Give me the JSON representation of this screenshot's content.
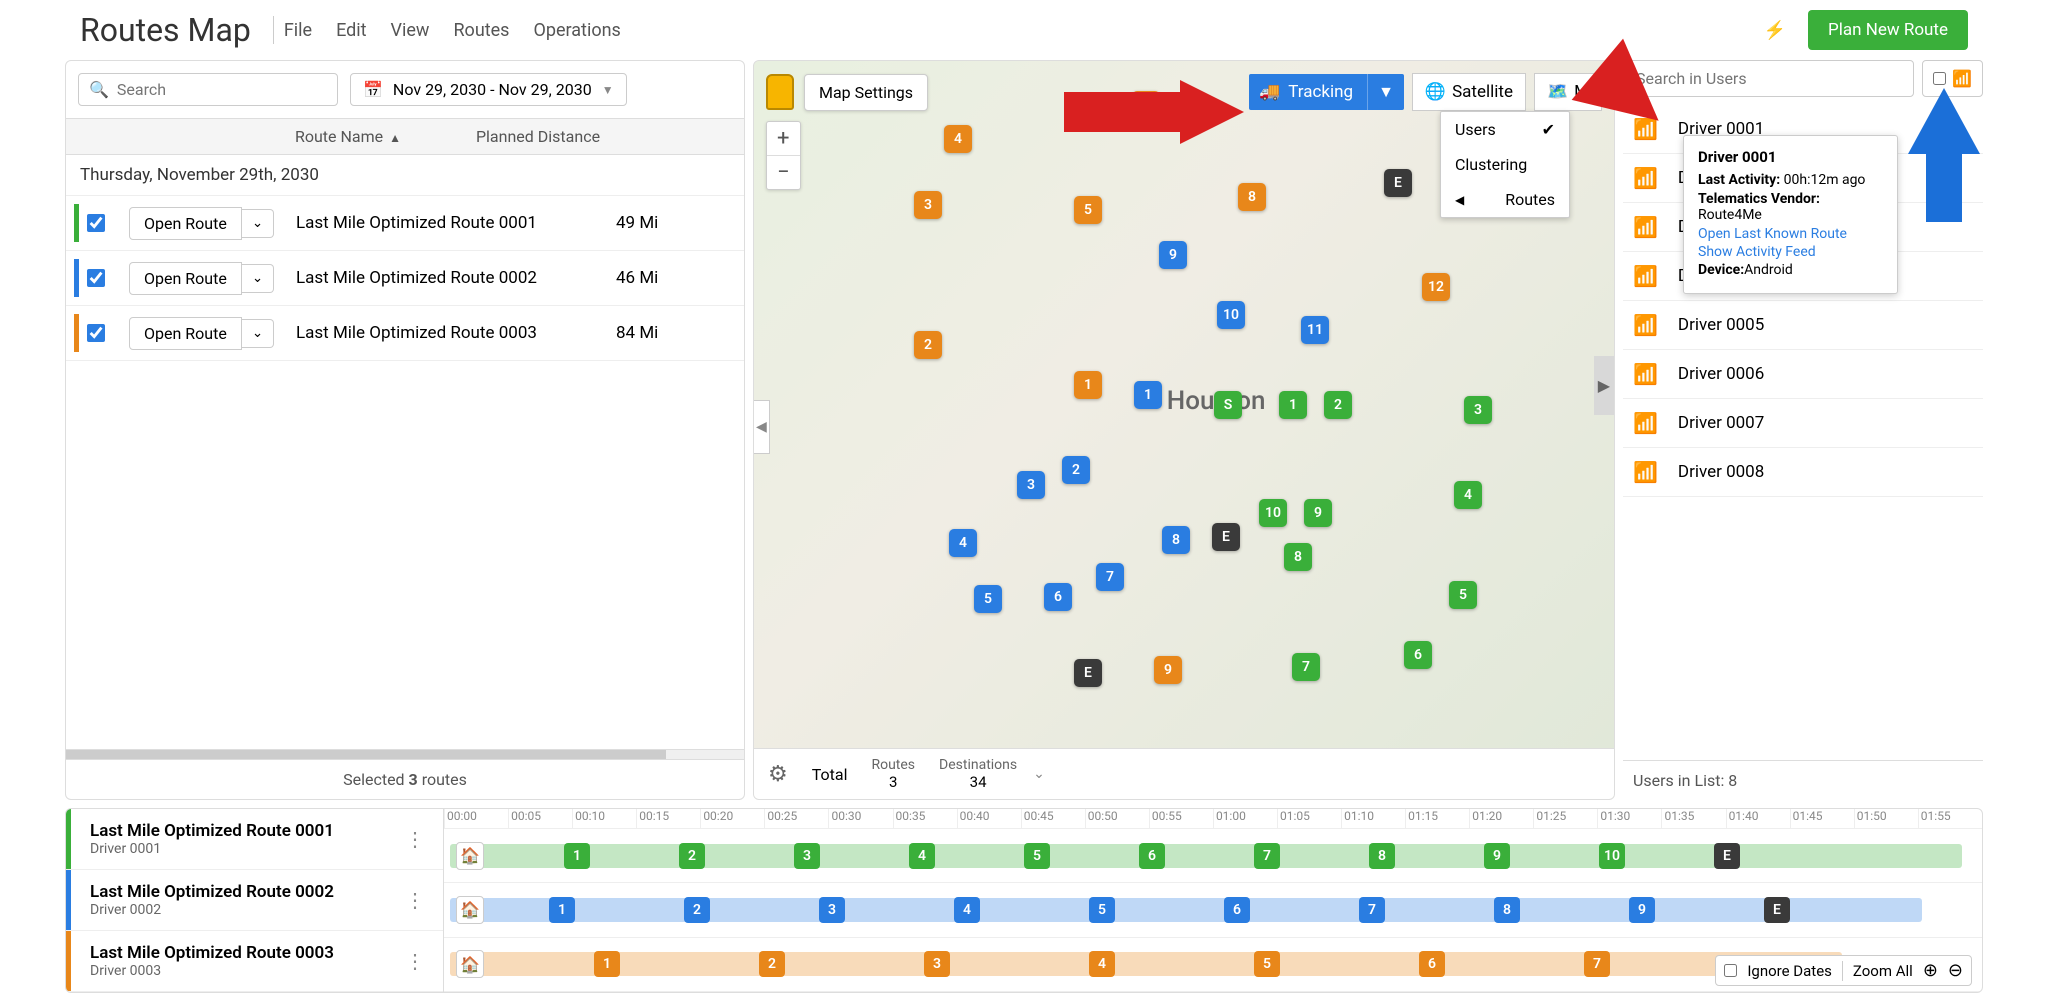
{
  "header": {
    "title": "Routes Map",
    "menu": [
      "File",
      "Edit",
      "View",
      "Routes",
      "Operations"
    ],
    "plan_btn": "Plan New Route"
  },
  "left": {
    "search_placeholder": "Search",
    "date_range": "Nov 29, 2030 - Nov 29, 2030",
    "th_route_name": "Route Name",
    "th_distance": "Planned Distance",
    "date_header": "Thursday, November 29th, 2030",
    "open_route": "Open Route",
    "routes": [
      {
        "name": "Last Mile Optimized Route 0001",
        "dist": "49 Mi",
        "color": "#3aaf3a"
      },
      {
        "name": "Last Mile Optimized Route 0002",
        "dist": "46 Mi",
        "color": "#2a7de1"
      },
      {
        "name": "Last Mile Optimized Route 0003",
        "dist": "84 Mi",
        "color": "#e8871a"
      }
    ],
    "selected_label_pre": "Selected ",
    "selected_count": "3",
    "selected_label_post": " routes"
  },
  "map": {
    "settings_btn": "Map Settings",
    "tracking_btn": "Tracking",
    "satellite_btn": "Satellite",
    "map_btn": "M",
    "city": "Houston",
    "dd_users": "Users",
    "dd_clustering": "Clustering",
    "dd_routes": "Routes",
    "footer_total": "Total",
    "footer_routes_lbl": "Routes",
    "footer_routes_val": "3",
    "footer_dest_lbl": "Destinations",
    "footer_dest_val": "34"
  },
  "users": {
    "search_placeholder": "Search in Users",
    "list": [
      "Driver 0001",
      "Driver 0002",
      "Driver 0003",
      "Driver 0004",
      "Driver 0005",
      "Driver 0006",
      "Driver 0007",
      "Driver 0008"
    ],
    "footer": "Users in List: 8",
    "tooltip": {
      "title": "Driver 0001",
      "last_activity_lbl": "Last Activity:",
      "last_activity_val": "00h:12m ago",
      "vendor_lbl": "Telematics Vendor:",
      "vendor_val": "Route4Me",
      "link1": "Open Last Known Route",
      "link2": "Show Activity Feed",
      "device_lbl": "Device:",
      "device_val": "Android"
    }
  },
  "timeline": {
    "ticks": [
      "00:00",
      "00:05",
      "00:10",
      "00:15",
      "00:20",
      "00:25",
      "00:30",
      "00:35",
      "00:40",
      "00:45",
      "00:50",
      "00:55",
      "01:00",
      "01:05",
      "01:10",
      "01:15",
      "01:20",
      "01:25",
      "01:30",
      "01:35",
      "01:40",
      "01:45",
      "01:50",
      "01:55"
    ],
    "rows": [
      {
        "name": "Last Mile Optimized Route 0001",
        "sub": "Driver 0001",
        "color": "#3aaf3a",
        "stops": [
          "1",
          "2",
          "3",
          "4",
          "5",
          "6",
          "7",
          "8",
          "9",
          "10",
          "E"
        ]
      },
      {
        "name": "Last Mile Optimized Route 0002",
        "sub": "Driver 0002",
        "color": "#2a7de1",
        "stops": [
          "1",
          "2",
          "3",
          "4",
          "5",
          "6",
          "7",
          "8",
          "9",
          "E"
        ]
      },
      {
        "name": "Last Mile Optimized Route 0003",
        "sub": "Driver 0003",
        "color": "#e8871a",
        "stops": [
          "1",
          "2",
          "3",
          "4",
          "5",
          "6",
          "7"
        ]
      }
    ],
    "ignore_dates": "Ignore Dates",
    "zoom_all": "Zoom All"
  }
}
